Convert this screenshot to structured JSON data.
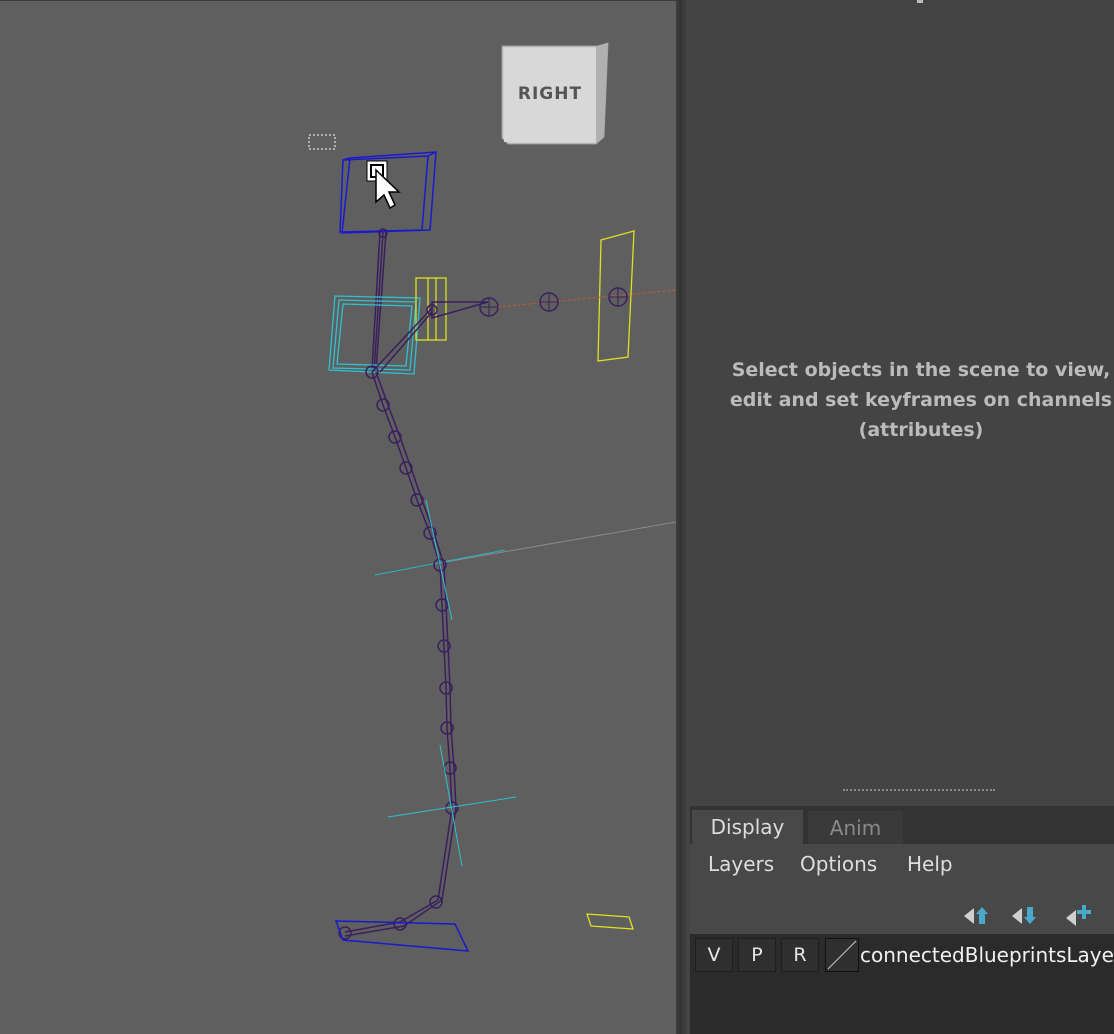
{
  "viewport": {
    "view_cube_label": "RIGHT"
  },
  "channel_box": {
    "message": "Select objects in the scene to view, edit and set keyframes on channels (attributes)"
  },
  "layer_editor": {
    "tabs": [
      {
        "label": "Display",
        "active": true
      },
      {
        "label": "Anim",
        "active": false
      }
    ],
    "menu": [
      {
        "label": "Layers"
      },
      {
        "label": "Options"
      },
      {
        "label": "Help"
      }
    ],
    "toolbar_icons": [
      "move-layer-up-icon",
      "move-layer-down-icon",
      "create-layer-icon"
    ],
    "layers": [
      {
        "visible": "V",
        "playback": "P",
        "reference": "R",
        "name": "connectedBlueprintsLayer"
      }
    ]
  },
  "colors": {
    "viewport_bg": "#5f5f5f",
    "panel_bg": "#444444",
    "joint_color": "#3a1f5e",
    "selection_blue": "#1a1acc",
    "locator_yellow": "#e0e020",
    "control_cyan": "#30c0d0",
    "accent_icon": "#4aa8c8"
  }
}
